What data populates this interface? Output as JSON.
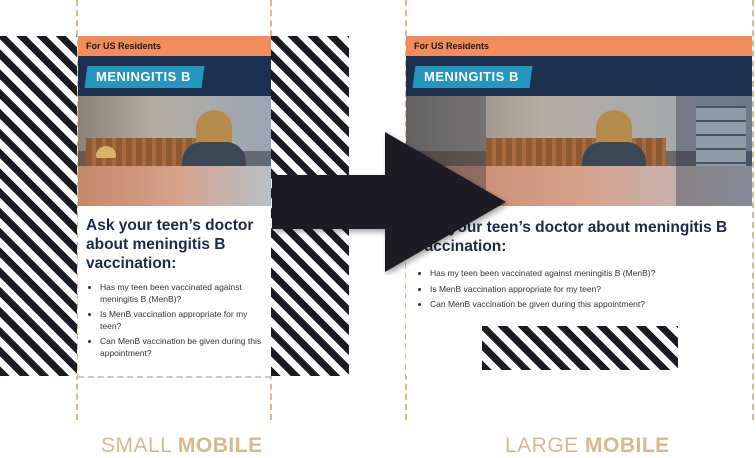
{
  "brand_colors": {
    "topbar": "#f28c5a",
    "navbar": "#1c3150",
    "logo": "#2596be",
    "heading": "#1c2b45",
    "guide": "#d9b98c"
  },
  "small_mobile": {
    "topbar_text": "For US Residents",
    "logo_text": "MENINGITIS B",
    "heading": "Ask your teen’s doctor about meningitis B vaccination:",
    "questions": [
      "Has my teen been vaccinated against meningitis B (MenB)?",
      "Is MenB vaccination appropriate for my teen?",
      "Can MenB vaccination be given during this appointment?"
    ]
  },
  "large_mobile": {
    "topbar_text": "For US Residents",
    "logo_text": "MENINGITIS B",
    "heading": "Ask your teen’s doctor about meningitis B vaccination:",
    "questions": [
      "Has my teen been vaccinated against meningitis B (MenB)?",
      "Is MenB vaccination appropriate for my teen?",
      "Can MenB vaccination be given during this appointment?"
    ]
  },
  "arrow_icon": "right-arrow-icon",
  "captions": {
    "small_light": "SMALL ",
    "small_bold": "MOBILE",
    "large_light": "LARGE ",
    "large_bold": "MOBILE"
  }
}
